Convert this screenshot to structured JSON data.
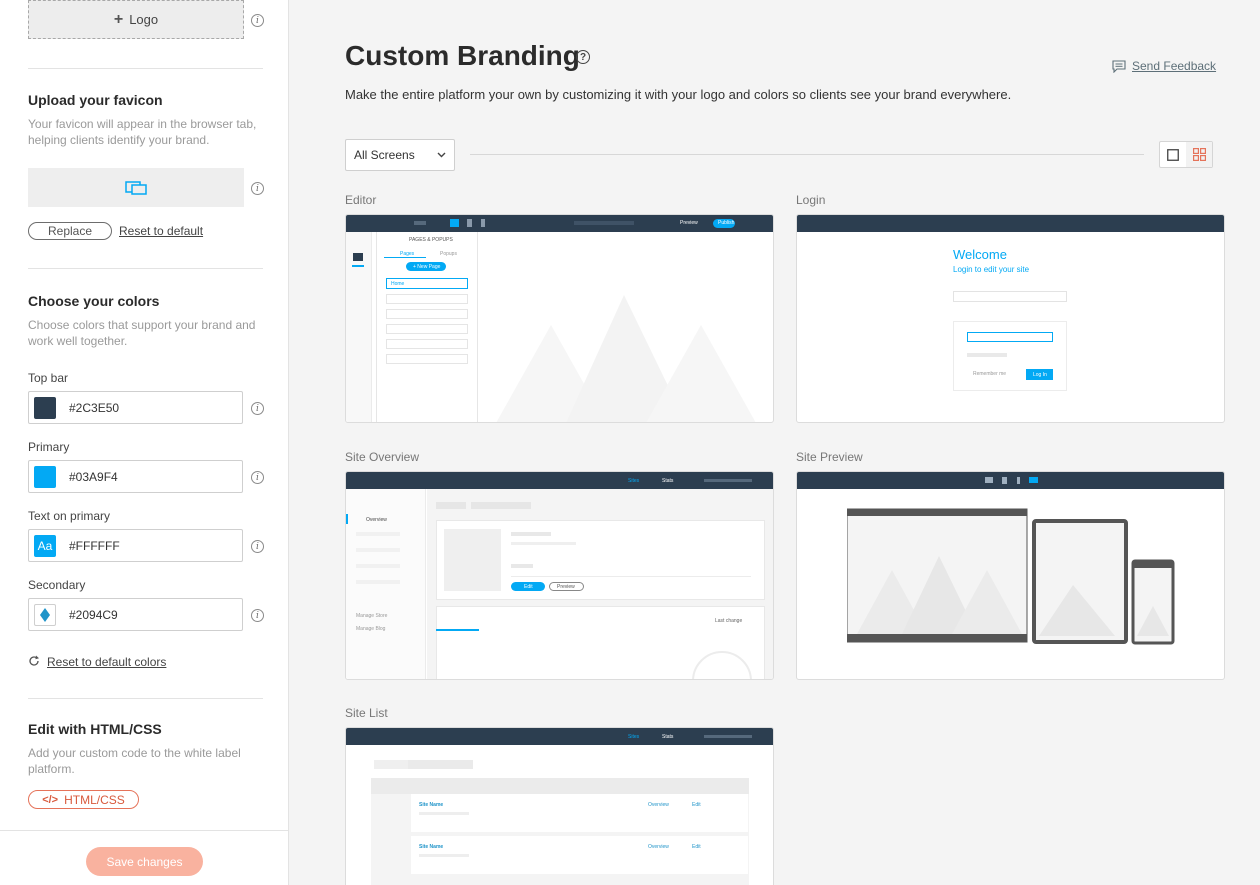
{
  "sidebar": {
    "logo_button": "Logo",
    "favicon": {
      "title": "Upload your favicon",
      "description": "Your favicon will appear in the browser tab, helping clients identify your brand.",
      "replace_label": "Replace",
      "reset_label": "Reset to default"
    },
    "colors": {
      "title": "Choose your colors",
      "description": "Choose colors that support your brand and work well together.",
      "fields": [
        {
          "label": "Top bar",
          "value": "#2C3E50",
          "swatch": "#2c3e50"
        },
        {
          "label": "Primary",
          "value": "#03A9F4",
          "swatch": "#03a9f4"
        },
        {
          "label": "Text on primary",
          "value": "#FFFFFF",
          "swatch": "#03a9f4",
          "swatch_text": "Aa"
        },
        {
          "label": "Secondary",
          "value": "#2094C9",
          "swatch": "#ffffff",
          "swatch_icon_color": "#2094c9"
        }
      ],
      "reset_label": "Reset to default colors"
    },
    "custom_code": {
      "title": "Edit with HTML/CSS",
      "description": "Add your custom code to the white label platform.",
      "button_label": "HTML/CSS"
    },
    "save_label": "Save changes"
  },
  "main": {
    "title": "Custom Branding",
    "description": "Make the entire platform your own by customizing it with your logo and colors so clients see your brand everywhere.",
    "feedback_label": "Send Feedback",
    "filter": {
      "selected": "All Screens"
    },
    "previews": [
      {
        "label": "Editor"
      },
      {
        "label": "Login"
      },
      {
        "label": "Site Overview"
      },
      {
        "label": "Site Preview"
      },
      {
        "label": "Site List"
      }
    ],
    "editor_preview": {
      "panel_title": "PAGES & POPUPS",
      "tab_pages": "Pages",
      "tab_popups": "Popups",
      "new_page": "+ New Page",
      "first_page": "Home",
      "preview_label": "Preview",
      "publish_label": "Publish"
    },
    "login_preview": {
      "welcome": "Welcome",
      "subtitle": "Login to edit your site",
      "login_button": "Log In",
      "remember": "Remember me"
    },
    "overview_preview": {
      "nav_item": "Overview",
      "tab_sites": "Sites",
      "tab_stats": "Stats",
      "manage_site": "Manage Store",
      "manage_blog": "Manage Blog",
      "edit_button": "Edit",
      "preview_button": "Preview",
      "last_change": "Last change"
    },
    "sitelist_preview": {
      "tab_sites": "Sites",
      "tab_stats": "Stats",
      "rows": [
        {
          "name": "Site Name",
          "action1": "Overview",
          "action2": "Edit"
        },
        {
          "name": "Site Name",
          "action1": "Overview",
          "action2": "Edit"
        }
      ]
    }
  },
  "colors": {
    "accent": "#03a9f4",
    "topbar": "#2c3e50",
    "secondary": "#2094c9",
    "save_button": "#f9b29f",
    "code_button": "#d8593c"
  }
}
